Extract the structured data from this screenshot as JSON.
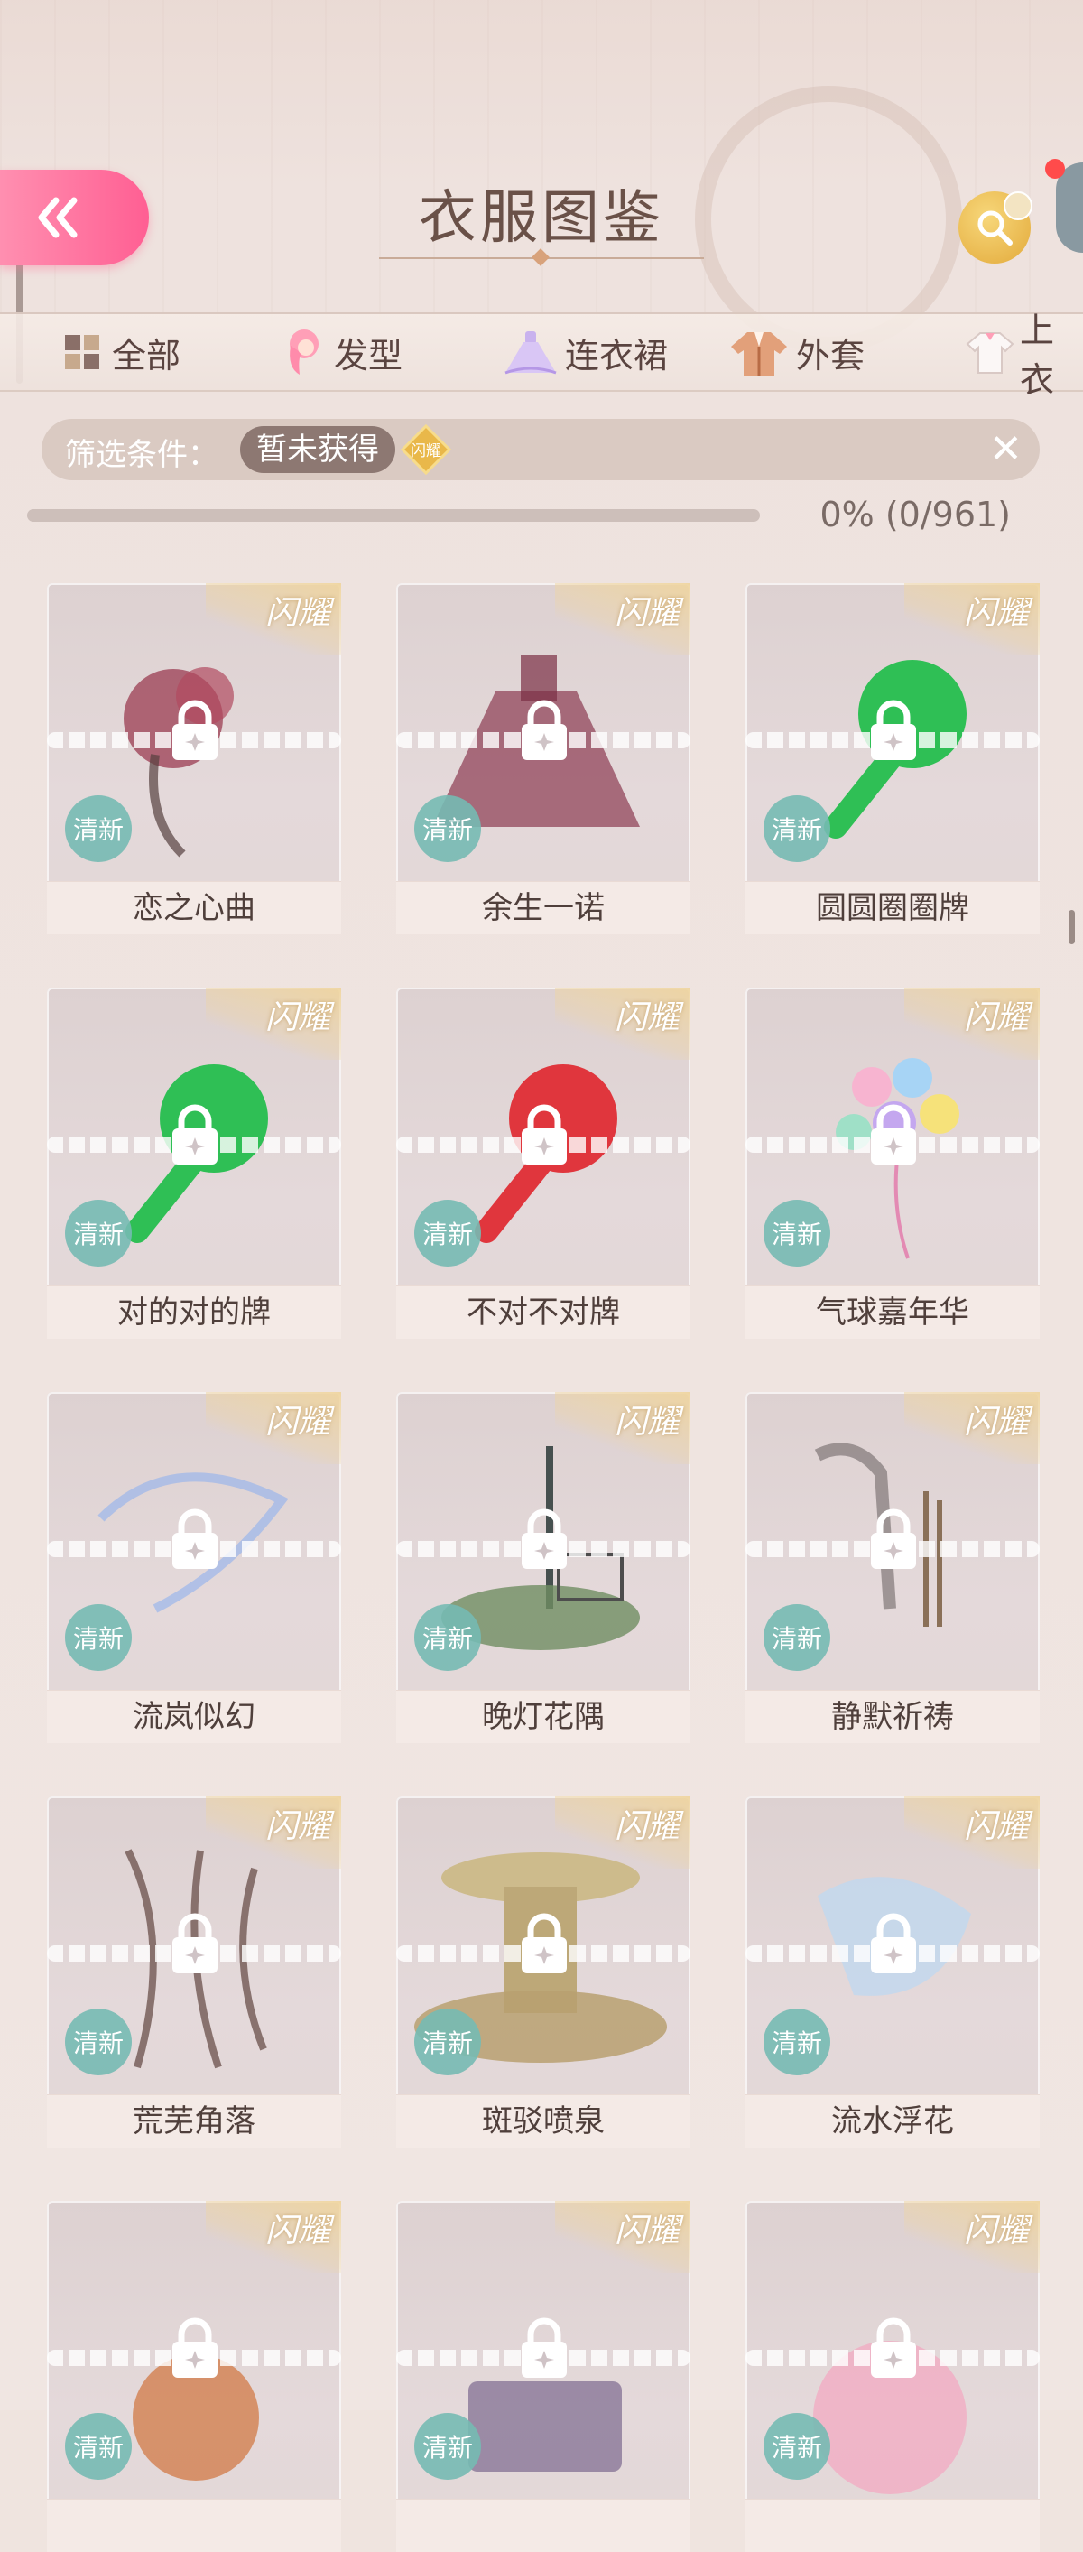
{
  "header": {
    "title": "衣服图鉴",
    "back_icon": "double-chevron-left-icon",
    "search_icon": "search-icon",
    "accent_pink": "#ff6b9b"
  },
  "tabs": [
    {
      "label": "全部",
      "icon": "grid-icon"
    },
    {
      "label": "发型",
      "icon": "hairstyle-icon"
    },
    {
      "label": "连衣裙",
      "icon": "dress-icon"
    },
    {
      "label": "外套",
      "icon": "coat-icon"
    },
    {
      "label": "上衣",
      "icon": "top-icon"
    }
  ],
  "filter": {
    "label": "筛选条件：",
    "chip": "暂未获得",
    "badge_text": "闪耀",
    "close_icon": "close-icon"
  },
  "progress": {
    "fraction": 0.0,
    "text": "0% (0/961)"
  },
  "card_common": {
    "ribbon": "闪耀",
    "badge": "清新"
  },
  "items": [
    {
      "name": "恋之心曲"
    },
    {
      "name": "余生一诺"
    },
    {
      "name": "圆圆圈圈牌"
    },
    {
      "name": "对的对的牌"
    },
    {
      "name": "不对不对牌"
    },
    {
      "name": "气球嘉年华"
    },
    {
      "name": "流岚似幻"
    },
    {
      "name": "晚灯花隅"
    },
    {
      "name": "静默祈祷"
    },
    {
      "name": "荒芜角落"
    },
    {
      "name": "斑驳喷泉"
    },
    {
      "name": "流水浮花"
    },
    {
      "name": ""
    },
    {
      "name": ""
    },
    {
      "name": ""
    }
  ]
}
